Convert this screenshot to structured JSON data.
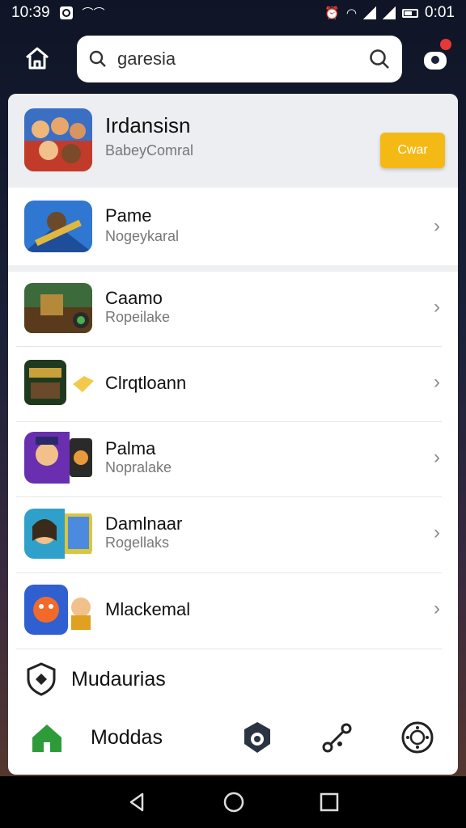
{
  "status": {
    "time": "10:39",
    "battery_time": "0:01"
  },
  "search": {
    "query": "garesia"
  },
  "featured": {
    "title": "Irdansisn",
    "subtitle": "BabeyComral",
    "button_label": "Cwar"
  },
  "apps": [
    {
      "title": "Pame",
      "subtitle": "Nogeykaral"
    },
    {
      "title": "Caamo",
      "subtitle": "Ropeilake"
    },
    {
      "title": "Clrqtloann",
      "subtitle": ""
    },
    {
      "title": "Palma",
      "subtitle": "Nopralake"
    },
    {
      "title": "Damlnaar",
      "subtitle": "Rogellaks"
    },
    {
      "title": "Mlackemal",
      "subtitle": ""
    }
  ],
  "promo": {
    "label": "Mudaurias"
  },
  "bottom_nav": {
    "active_label": "Moddas"
  },
  "colors": {
    "accent": "#f5b916",
    "home_green": "#2e9b3a",
    "badge_red": "#e53935"
  },
  "icons": [
    "home-icon",
    "search-icon",
    "profile-icon",
    "chevron-right-icon",
    "shield-icon",
    "game-icon",
    "share-icon",
    "settings-icon",
    "back-icon",
    "recents-icon"
  ]
}
